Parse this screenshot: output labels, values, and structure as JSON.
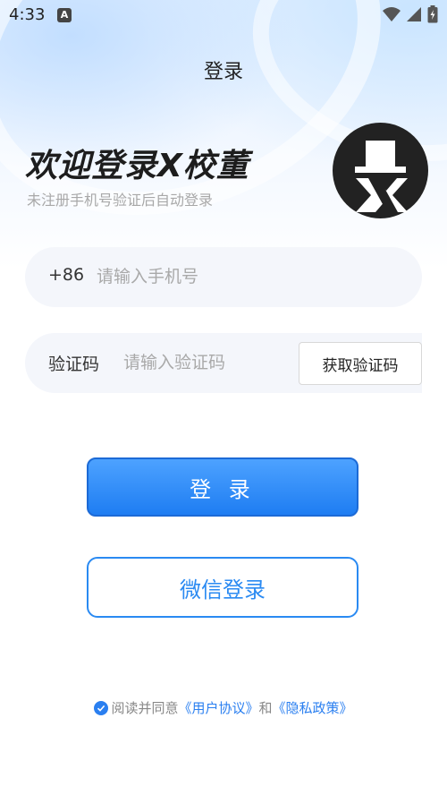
{
  "status_bar": {
    "time": "4:33",
    "notification_badge": "A"
  },
  "header": {
    "title": "登录"
  },
  "welcome": {
    "title": "欢迎登录X校董",
    "subtitle": "未注册手机号验证后自动登录"
  },
  "phone": {
    "country_code": "+86",
    "placeholder": "请输入手机号",
    "value": ""
  },
  "code": {
    "label": "验证码",
    "placeholder": "请输入验证码",
    "value": "",
    "get_code_label": "获取验证码"
  },
  "buttons": {
    "login": "登 录",
    "wechat_login": "微信登录"
  },
  "agreement": {
    "prefix": "阅读并同意",
    "user_agreement": "《用户协议》",
    "and": "和",
    "privacy_policy": "《隐私政策》",
    "checked": true
  },
  "colors": {
    "accent": "#2a7ff0",
    "button_gradient_top": "#4da2ff",
    "button_gradient_bottom": "#1e7df2"
  },
  "icons": [
    "wifi-icon",
    "signal-icon",
    "battery-icon",
    "checkmark-icon",
    "top-hat-x-logo"
  ]
}
